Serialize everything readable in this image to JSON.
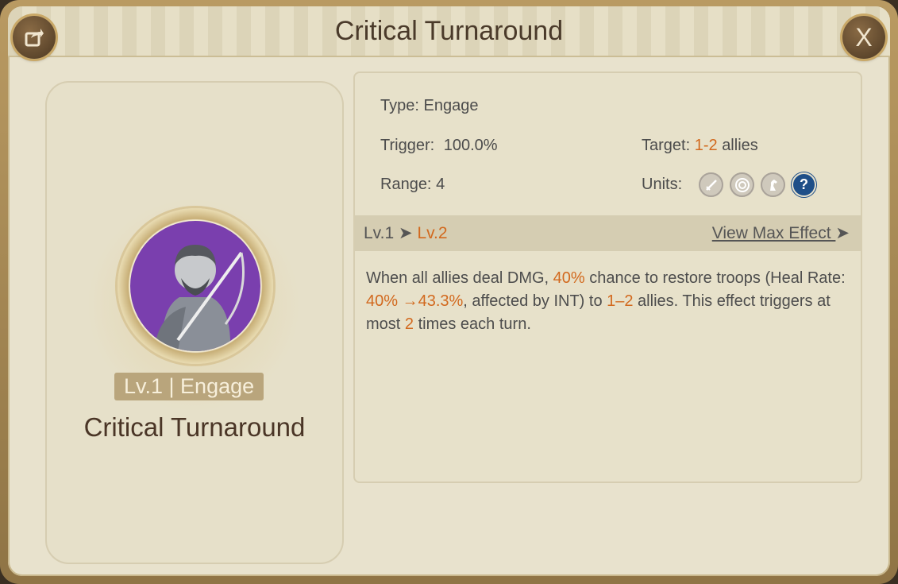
{
  "header": {
    "title": "Critical Turnaround",
    "share_icon": "share-icon",
    "close_label": "X"
  },
  "left": {
    "level_badge": "Lv.1 | Engage",
    "skill_name": "Critical Turnaround"
  },
  "details": {
    "type_label": "Type:",
    "type_value": "Engage",
    "trigger_label": "Trigger:",
    "trigger_value": "100.0%",
    "range_label": "Range:",
    "range_value": "4",
    "target_label": "Target:",
    "target_value": "1-2",
    "target_suffix": "allies",
    "units_label": "Units:",
    "units": [
      "sword-icon",
      "target-icon",
      "horse-icon",
      "help-icon"
    ]
  },
  "level_bar": {
    "current": "Lv.1",
    "arrow": "➤",
    "next": "Lv.2",
    "view_max": "View Max Effect",
    "view_max_arrow": "➤"
  },
  "description": {
    "part1": "When all allies deal DMG, ",
    "chance": "40%",
    "part2": " chance to restore troops (Heal Rate: ",
    "heal": "40% →43.3%",
    "part3": ", affected by INT) to ",
    "targets": "1–2",
    "part4": " allies. This effect triggers at most ",
    "times": "2",
    "part5": " times each turn."
  },
  "colors": {
    "accent": "#d2691e",
    "text": "#4c4c4c",
    "title": "#4a3a2a",
    "portrait_bg": "#7a3fae",
    "help_icon": "#1f4f88"
  }
}
